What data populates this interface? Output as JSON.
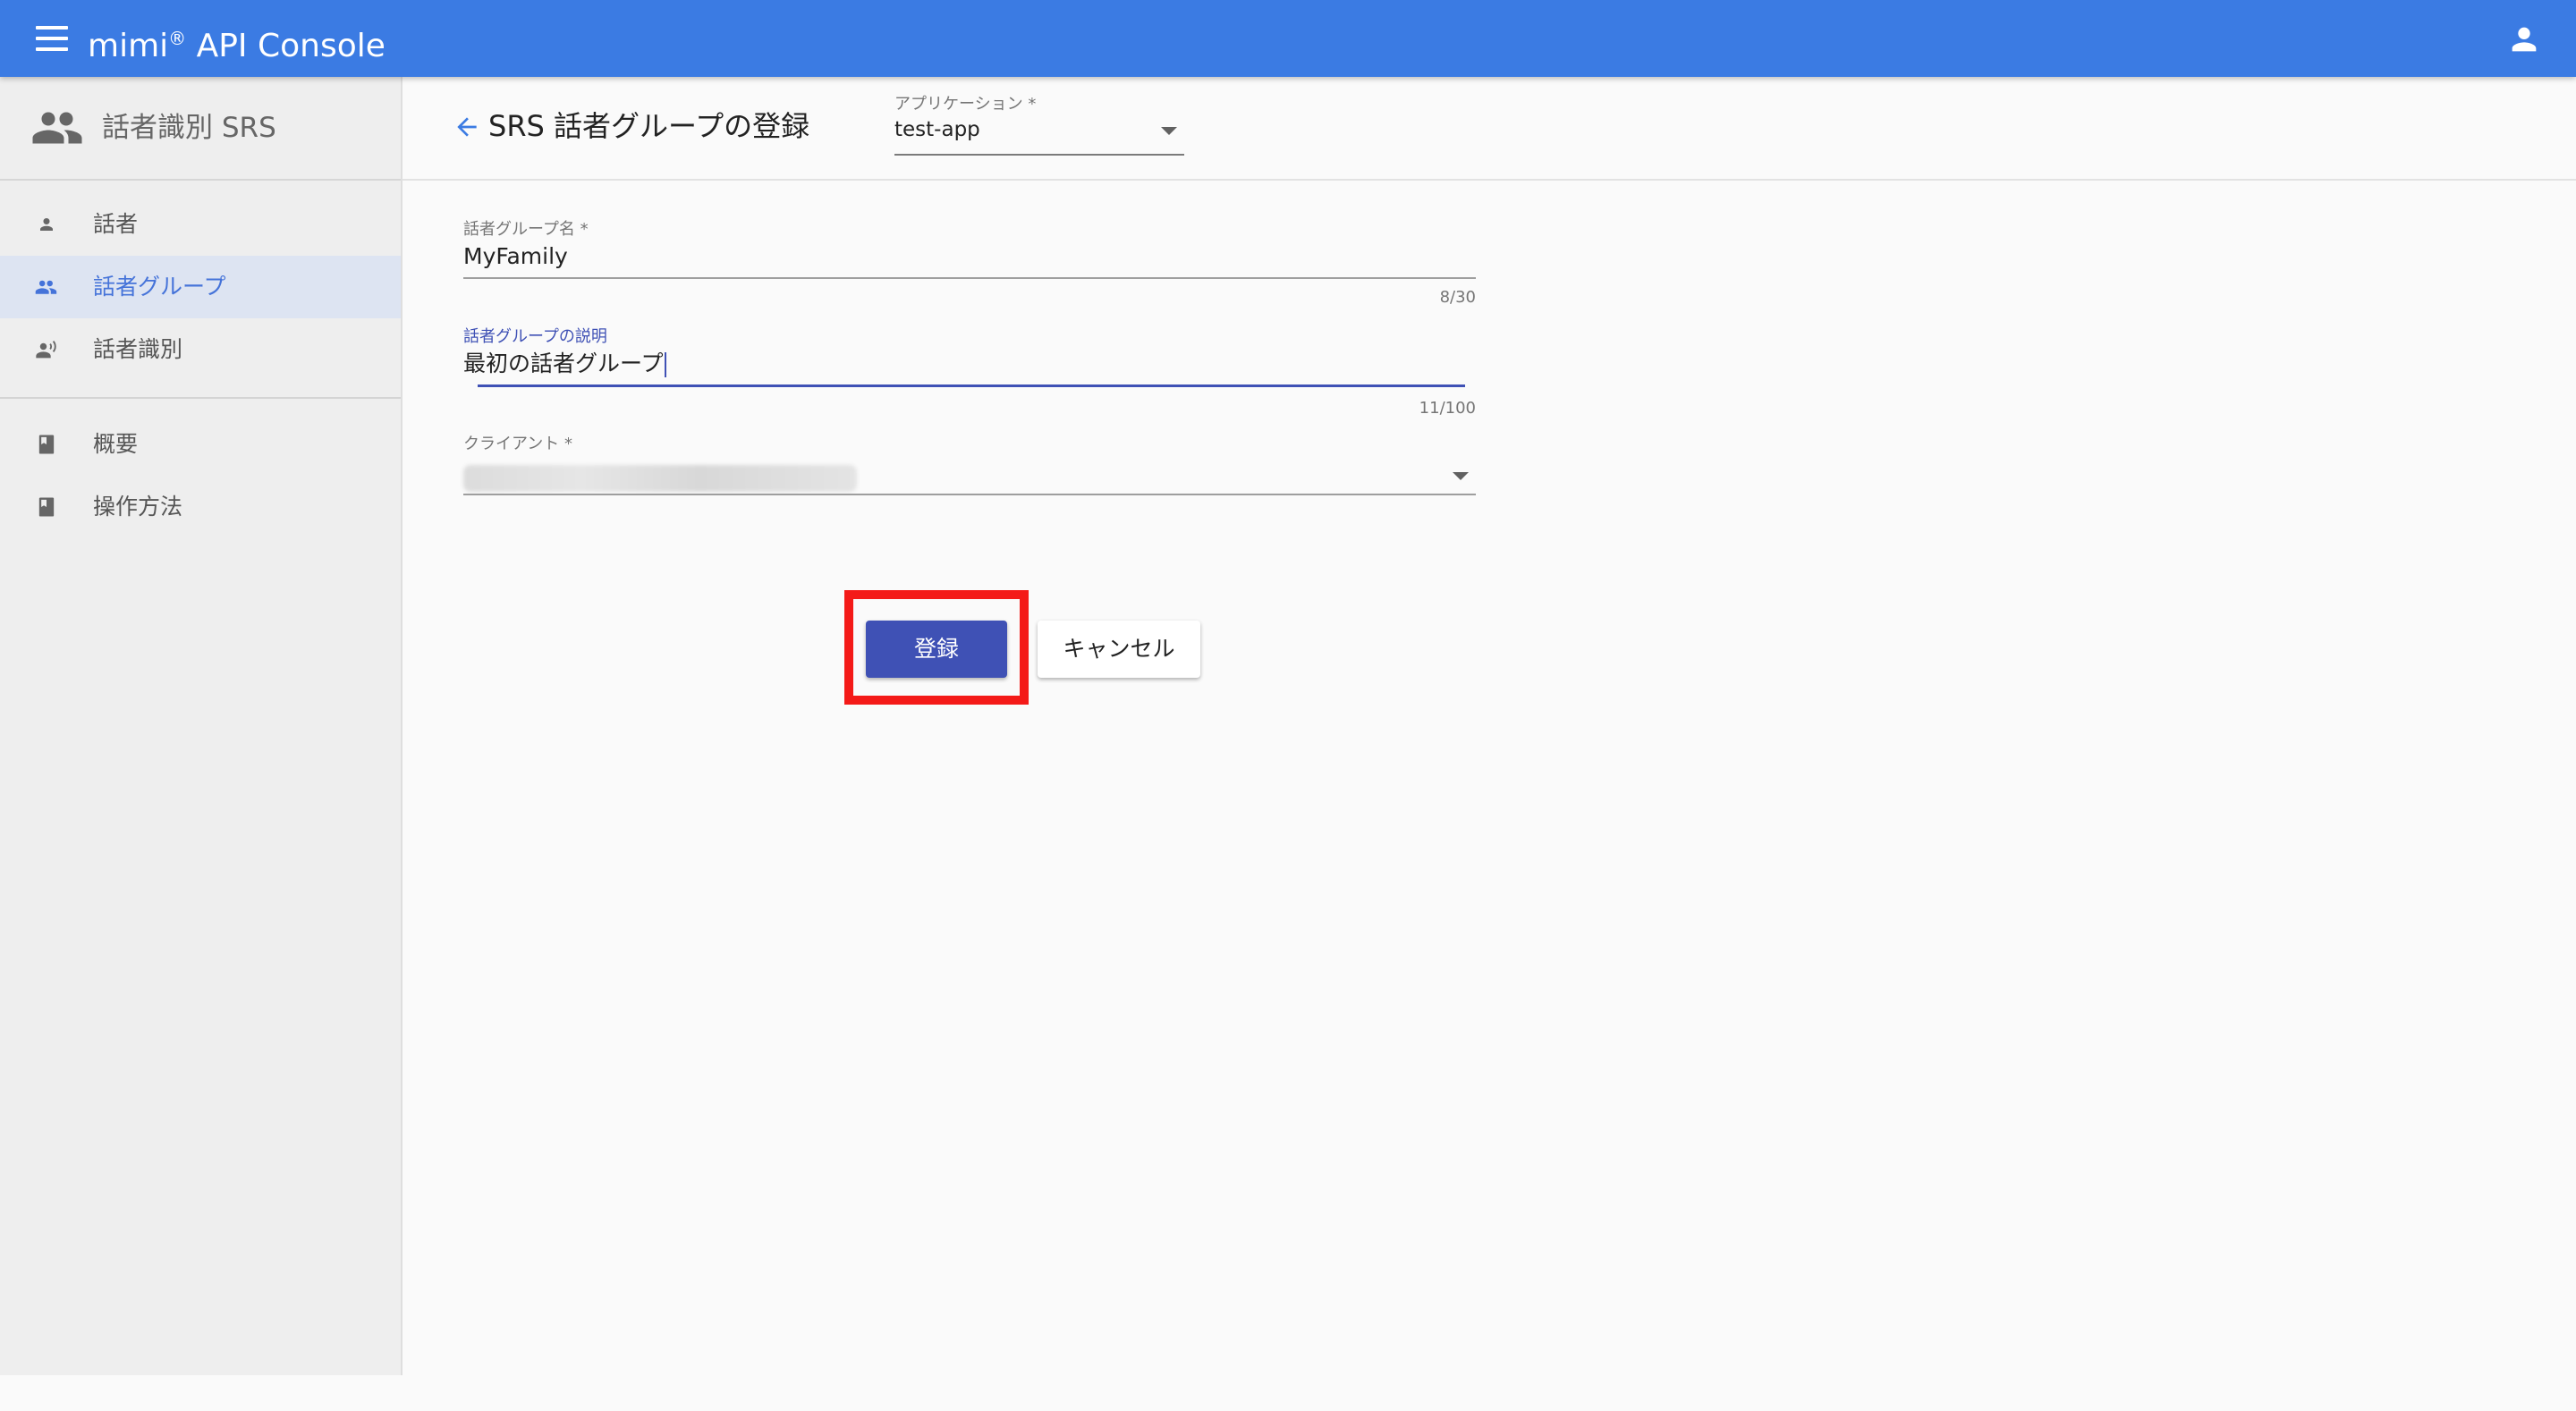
{
  "app": {
    "title_main": "mimi",
    "title_reg": "®",
    "title_rest": " API Console",
    "accent": "#3b7be3"
  },
  "sidebar": {
    "title": "話者識別 SRS",
    "items": [
      {
        "label": "話者",
        "icon": "person-icon",
        "active": false
      },
      {
        "label": "話者グループ",
        "icon": "group-icon",
        "active": true
      },
      {
        "label": "話者識別",
        "icon": "record-voice-icon",
        "active": false
      },
      {
        "label": "概要",
        "icon": "book-icon",
        "active": false
      },
      {
        "label": "操作方法",
        "icon": "book-icon",
        "active": false
      }
    ]
  },
  "page": {
    "title": "SRS 話者グループの登録",
    "application_label": "アプリケーション *",
    "application_value": "test-app"
  },
  "form": {
    "name": {
      "label": "話者グループ名 *",
      "value": "MyFamily",
      "counter": "8/30"
    },
    "description": {
      "label": "話者グループの説明",
      "value": "最初の話者グループ",
      "counter": "11/100"
    },
    "client": {
      "label": "クライアント *",
      "value": ""
    }
  },
  "buttons": {
    "submit": "登録",
    "cancel": "キャンセル"
  },
  "colors": {
    "primary_button": "#3f51b5",
    "highlight": "#f41a18",
    "active_nav": "#4573d9"
  }
}
